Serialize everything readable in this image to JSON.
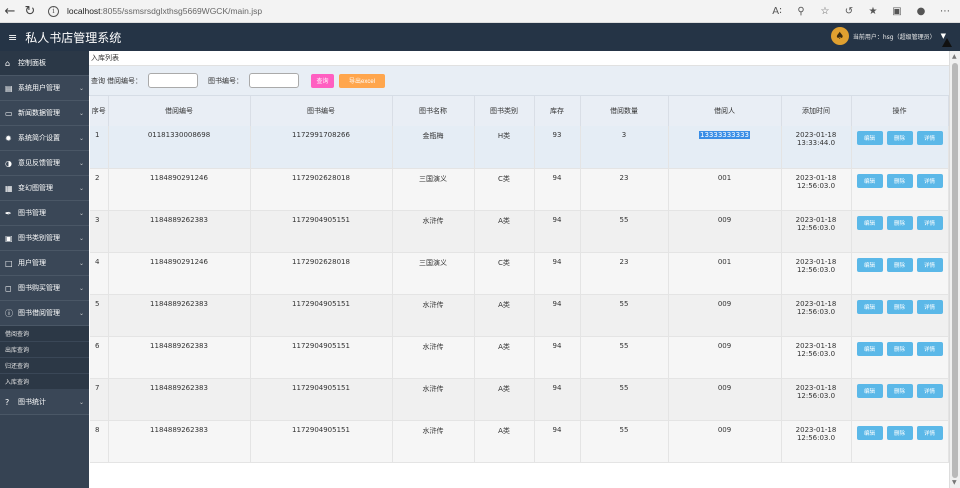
{
  "browser": {
    "url_host": "localhost",
    "url_rest": ":8055/ssmsrsdglxthsg5669WGCK/main.jsp"
  },
  "header": {
    "title": "私人书店管理系统",
    "user_text": "当前用户：hsg（超级管理员）"
  },
  "sidebar": {
    "items": [
      {
        "label": "控制面板",
        "icon": "home-icon"
      },
      {
        "label": "系统用户管理",
        "icon": "users-icon"
      },
      {
        "label": "新闻数据管理",
        "icon": "monitor-icon"
      },
      {
        "label": "系统简介设置",
        "icon": "gear-icon"
      },
      {
        "label": "意见反馈管理",
        "icon": "pie-icon"
      },
      {
        "label": "变幻图管理",
        "icon": "image-icon"
      },
      {
        "label": "图书管理",
        "icon": "pen-icon"
      },
      {
        "label": "图书类别管理",
        "icon": "edit-icon"
      },
      {
        "label": "用户管理",
        "icon": "user-icon"
      },
      {
        "label": "图书购买管理",
        "icon": "cart-icon"
      },
      {
        "label": "图书借阅管理",
        "icon": "info-icon"
      }
    ],
    "sub_items": [
      "借阅查询",
      "出库查询",
      "归还查询",
      "入库查询"
    ],
    "last_item": {
      "label": "图书统计",
      "icon": "question-icon"
    }
  },
  "main": {
    "breadcrumb": "入库列表",
    "search": {
      "label_query": "查询",
      "label_borrow_no": "借阅编号：",
      "label_book_no": "图书编号：",
      "search_btn": "查询",
      "export_btn": "导出excel"
    },
    "table": {
      "columns": [
        "序号",
        "借阅编号",
        "图书编号",
        "图书名称",
        "图书类别",
        "库存",
        "借阅数量",
        "借阅人",
        "添加时间",
        "操作"
      ],
      "rows": [
        {
          "idx": "1",
          "borrow_no": "01181330008698",
          "book_no": "1172991708266",
          "name": "金瓶梅",
          "cat": "H类",
          "stock": "93",
          "qty": "3",
          "person": "13333333333",
          "date": "2023-01-18",
          "time": "13:33:44.0"
        },
        {
          "idx": "2",
          "borrow_no": "1184890291246",
          "book_no": "1172902628018",
          "name": "三国演义",
          "cat": "C类",
          "stock": "94",
          "qty": "23",
          "person": "001",
          "date": "2023-01-18",
          "time": "12:56:03.0"
        },
        {
          "idx": "3",
          "borrow_no": "1184889262383",
          "book_no": "1172904905151",
          "name": "水浒传",
          "cat": "A类",
          "stock": "94",
          "qty": "55",
          "person": "009",
          "date": "2023-01-18",
          "time": "12:56:03.0"
        },
        {
          "idx": "4",
          "borrow_no": "1184890291246",
          "book_no": "1172902628018",
          "name": "三国演义",
          "cat": "C类",
          "stock": "94",
          "qty": "23",
          "person": "001",
          "date": "2023-01-18",
          "time": "12:56:03.0"
        },
        {
          "idx": "5",
          "borrow_no": "1184889262383",
          "book_no": "1172904905151",
          "name": "水浒传",
          "cat": "A类",
          "stock": "94",
          "qty": "55",
          "person": "009",
          "date": "2023-01-18",
          "time": "12:56:03.0"
        },
        {
          "idx": "6",
          "borrow_no": "1184889262383",
          "book_no": "1172904905151",
          "name": "水浒传",
          "cat": "A类",
          "stock": "94",
          "qty": "55",
          "person": "009",
          "date": "2023-01-18",
          "time": "12:56:03.0"
        },
        {
          "idx": "7",
          "borrow_no": "1184889262383",
          "book_no": "1172904905151",
          "name": "水浒传",
          "cat": "A类",
          "stock": "94",
          "qty": "55",
          "person": "009",
          "date": "2023-01-18",
          "time": "12:56:03.0"
        },
        {
          "idx": "8",
          "borrow_no": "1184889262383",
          "book_no": "1172904905151",
          "name": "水浒传",
          "cat": "A类",
          "stock": "94",
          "qty": "55",
          "person": "009",
          "date": "2023-01-18",
          "time": "12:56:03.0"
        }
      ],
      "actions": {
        "edit": "编辑",
        "delete": "删除",
        "detail": "详情"
      }
    }
  }
}
